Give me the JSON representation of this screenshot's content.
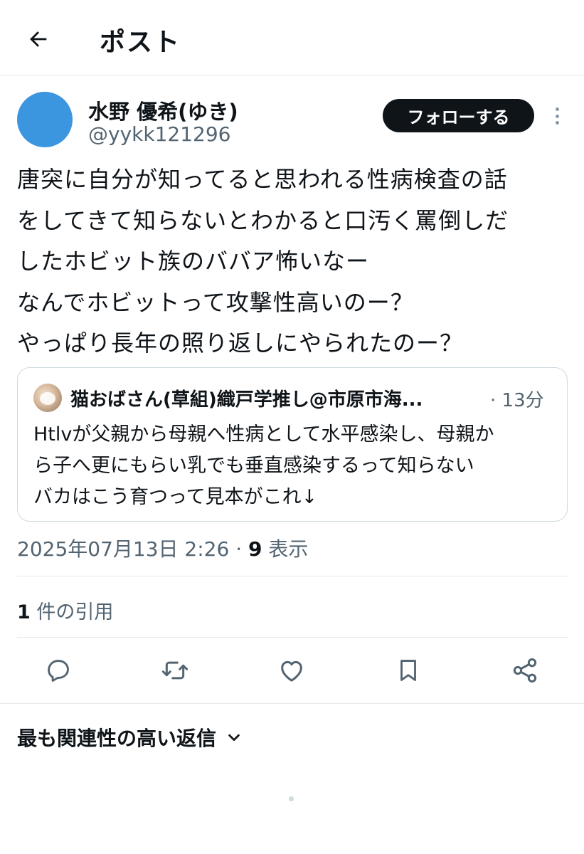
{
  "header": {
    "title": "ポスト",
    "back_icon": "arrow-left-icon"
  },
  "author": {
    "name": "水野 優希(ゆき)",
    "handle": "@yykk121296",
    "avatar_color": "#3b96df"
  },
  "follow_label": "フォローする",
  "post": {
    "lines": [
      "唐突に自分が知ってると思われる性病検査の話",
      "をしてきて知らないとわかると口汚く罵倒しだ",
      "したホビット族のババア怖いなー",
      "なんでホビットって攻撃性高いのー？",
      "やっぱり長年の照り返しにやられたのー？"
    ]
  },
  "quoted": {
    "name": "猫おばさん(草組)織戸学推し@市原市海...",
    "time": "· 13分",
    "lines": [
      "Htlvが父親から母親へ性病として水平感染し、母親か",
      "ら子へ更にもらい乳でも垂直感染するって知らない",
      "バカはこう育つって見本がこれ↓"
    ]
  },
  "meta": {
    "datetime": "2025年07月13日 2:26",
    "separator": " · ",
    "views": "9",
    "views_label": " 表示"
  },
  "quotes": {
    "count": "1",
    "label": " 件の引用"
  },
  "actions": [
    "reply-icon",
    "retweet-icon",
    "like-icon",
    "bookmark-icon",
    "share-icon"
  ],
  "replies_sort": {
    "label": "最も関連性の高い返信",
    "icon": "chevron-down-icon"
  },
  "colors": {
    "text": "#0f1419",
    "secondary": "#536471",
    "border": "#cfd9de",
    "follow_bg": "#0f1419"
  }
}
